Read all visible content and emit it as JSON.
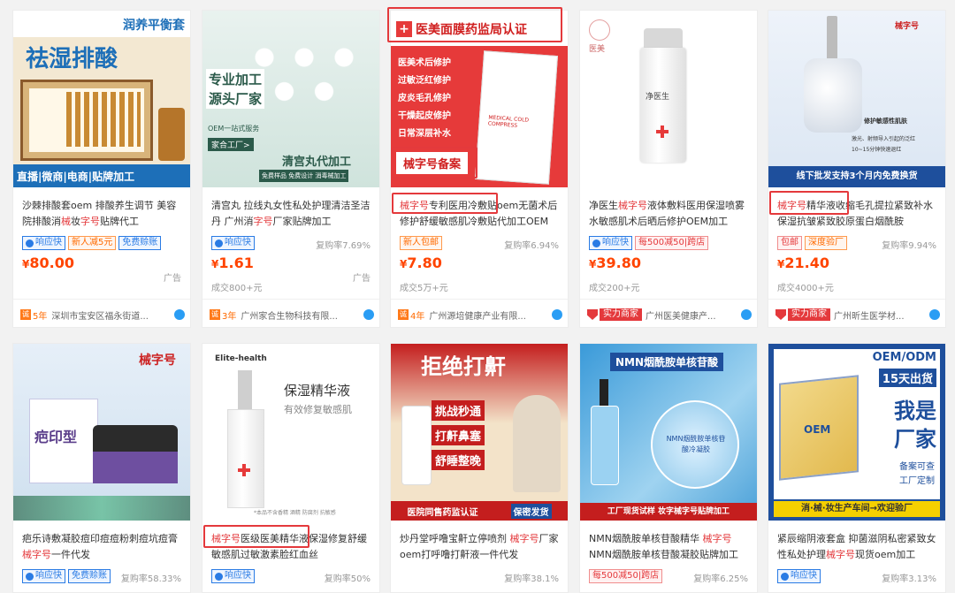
{
  "cards": [
    {
      "img": {
        "top": "润养平衡套",
        "big": "祛湿排酸",
        "bottom": "直播|微商|电商|贴牌加工"
      },
      "title_pre": "沙棘排酸套oem 排酸养生调节 美容院排酸消",
      "title_hl": "械",
      "title_mid": "妆",
      "title_hl2": "字号",
      "title_post": "贴牌代工",
      "tags": [
        "响应快",
        "新人减5元",
        "免费赊账"
      ],
      "aux": "",
      "price": "80.00",
      "ad": "广告",
      "deal": "",
      "years": "5年",
      "shop": "深圳市宝安区福永街道..."
    },
    {
      "img": {
        "a": "专业加工",
        "b": "源头厂家",
        "c": "OEM一站式服务",
        "d": "家合工厂>",
        "e": "清宫丸代加工",
        "f": "免费样品  免费设计  消毒械加工"
      },
      "title_pre": "清宫丸 拉线丸女性私处护理清洁圣洁丹 广州消",
      "title_hl": "字号",
      "title_post": "厂家贴牌加工",
      "tags": [
        "响应快"
      ],
      "aux": "复购率7.69%",
      "price": "1.61",
      "ad": "广告",
      "deal": "成交800+元",
      "years": "3年",
      "shop": "广州家合生物科技有限..."
    },
    {
      "img": {
        "head": "医美面膜药监局认证",
        "items": [
          "医美术后修护",
          "过敏泛红修护",
          "皮炎毛孔修护",
          "干燥起皮修护",
          "日常深层补水"
        ],
        "foot": "械字号备案",
        "pack": "MEDICAL COLD COMPRESS"
      },
      "title_hl": "械字号",
      "title_post": "专利医用冷敷贴oem无菌术后修护舒缓敏感肌冷敷贴代加工OEM",
      "tags": [
        "新人包邮"
      ],
      "aux": "复购率6.94%",
      "price": "7.80",
      "ad": "",
      "deal": "成交5万+元",
      "years": "4年",
      "shop": "广州源培健康产业有限..."
    },
    {
      "img": {
        "brand": "医美",
        "label": "净医生"
      },
      "title_pre": "净医生",
      "title_hl": "械字号",
      "title_post": "液体敷料医用保湿喷雾水敏感肌术后晒后修护OEM加工",
      "tags": [
        "响应快",
        "每500减50|跨店"
      ],
      "aux": "",
      "price": "39.80",
      "ad": "",
      "deal": "成交200+元",
      "power": "实力商家",
      "shop": "广州医美健康产..."
    },
    {
      "img": {
        "brand": "械字号",
        "promo": "线下批发支持3个月内免费换货",
        "l1": "修护敏感性肌肤",
        "l2": "激光、射频导入引起的泛红",
        "l3": "10~15分钟快速退红"
      },
      "title_hl": "械字号",
      "title_post": "精华液收缩毛孔提拉紧致补水保湿抗皱紧致胶原蛋白烟酰胺",
      "tags": [
        "包邮",
        "深度验厂"
      ],
      "aux": "复购率9.94%",
      "price": "21.40",
      "ad": "",
      "deal": "成交4000+元",
      "power": "实力商家",
      "shop": "广州昕生医学材..."
    },
    {
      "img": {
        "brand": "械字号",
        "product": "疤印型"
      },
      "title_pre": "疤乐诗敷凝胶痘印痘痘粉刺痘坑痘膏",
      "title_hl": "械字号",
      "title_post": "一件代发",
      "tags": [
        "响应快",
        "免费赊账"
      ],
      "aux": "复购率58.33%"
    },
    {
      "img": {
        "brand": "Elite-health",
        "t1": "保湿精华液",
        "t2": "有效修复敏感肌",
        "t3": "*本品不含香精  酒精  防腐剂  抗敏感"
      },
      "title_hl": "械字号",
      "title_post": "医级医美精华液保湿修复舒缓敏感肌过敏激素脸红血丝",
      "tags": [
        "响应快"
      ],
      "aux": "复购率50%"
    },
    {
      "img": {
        "big": "拒绝打鼾",
        "a": "挑战秒通",
        "b": "打鼾鼻塞",
        "c": "舒睡整晚",
        "foot1": "医院同售药监认证",
        "foot2": "保密发货"
      },
      "title_pre": "炒丹堂呼噜宝鼾立停喷剂 ",
      "title_hl": "械字号",
      "title_post": "厂家oem打呼噜打鼾液一件代发",
      "tags": [],
      "aux": "复购率38.1%"
    },
    {
      "img": {
        "head": "NMN烟酰胺单核苷酸",
        "jar": "NMN烟酰胺单核苷酸冷凝胶",
        "foot": "工厂现货试样  妆字械字号贴牌加工"
      },
      "title_pre": "NMN烟酰胺单核苷酸精华 ",
      "title_hl": "械字号",
      "title_post": "NMN烟酰胺单核苷酸凝胶贴牌加工OEM",
      "tags": [
        "每500减50|跨店"
      ],
      "aux": "复购率6.25%"
    },
    {
      "img": {
        "a": "OEM/ODM",
        "b": "15天出货",
        "c": "我是",
        "d": "厂家",
        "e": "备案可查",
        "f": "工厂定制",
        "foot": "消·械·妆生产车间→欢迎验厂",
        "box": "OEM"
      },
      "title_pre": "紧辰缩阴液套盒 抑菌滋阴私密紧致女性私处护理",
      "title_hl": "械字号",
      "title_post": "现货oem加工",
      "tags": [
        "响应快"
      ],
      "aux": "复购率3.13%"
    }
  ],
  "colors": {
    "accent": "#e4393c",
    "price": "#ff4400",
    "blue": "#2a7be4"
  }
}
